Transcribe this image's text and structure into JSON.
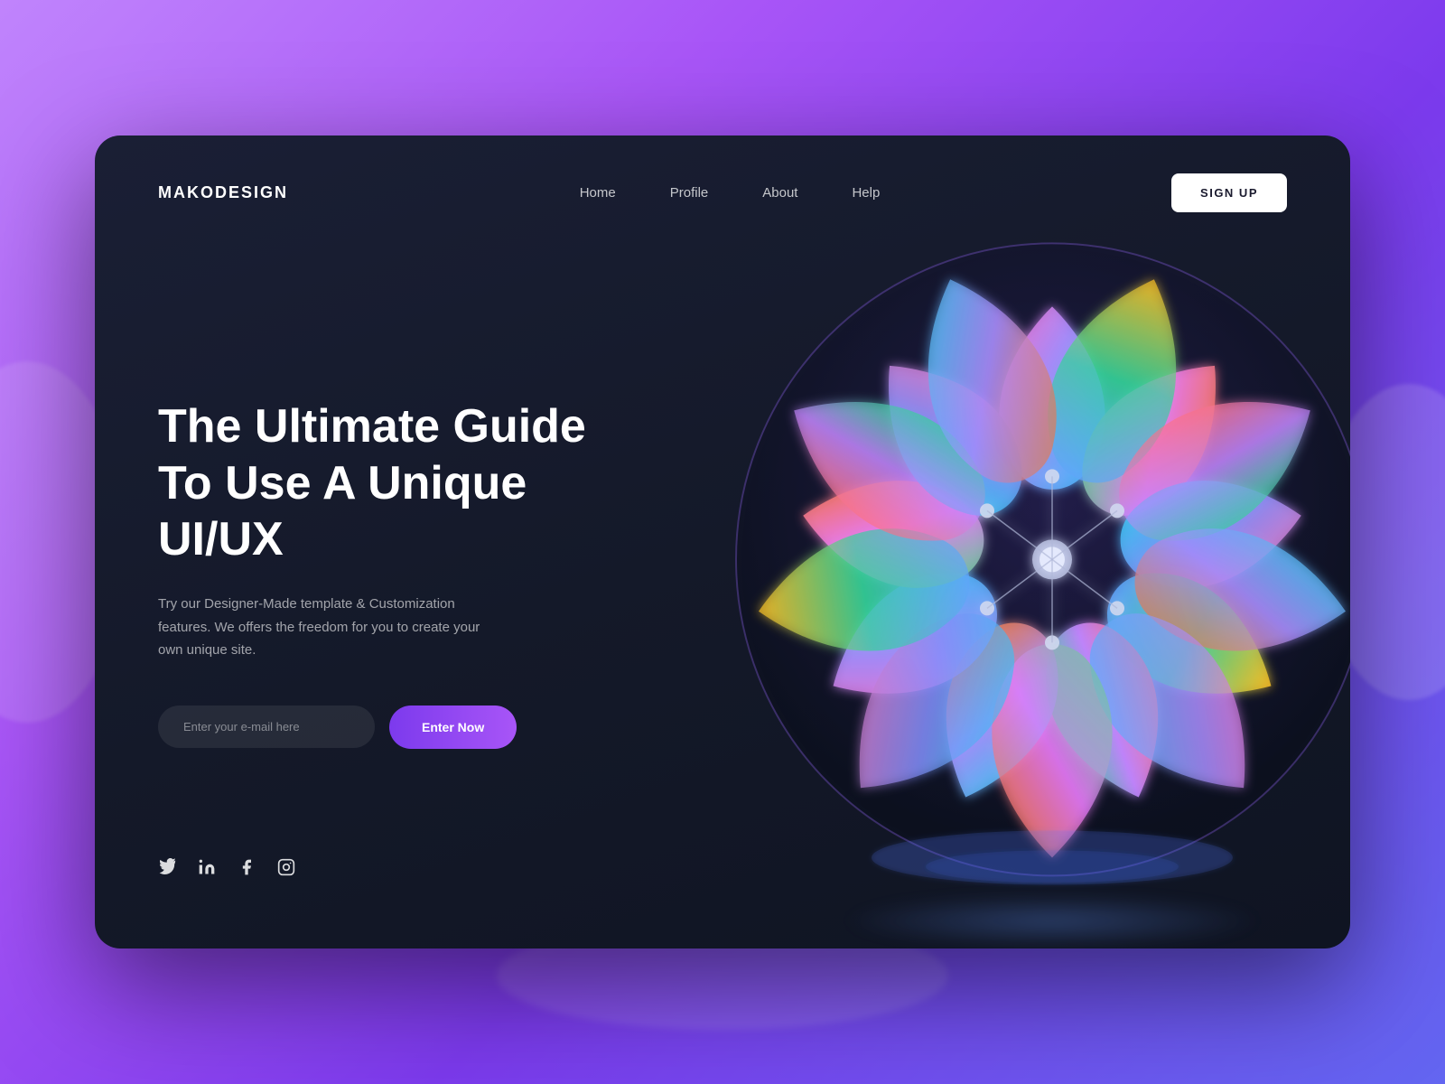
{
  "background": {
    "gradient_start": "#c084fc",
    "gradient_end": "#6366f1"
  },
  "card": {
    "bg": "#141929"
  },
  "navbar": {
    "logo": "MAKODESIGN",
    "links": [
      {
        "label": "Home",
        "href": "#"
      },
      {
        "label": "Profile",
        "href": "#"
      },
      {
        "label": "About",
        "href": "#"
      },
      {
        "label": "Help",
        "href": "#"
      }
    ],
    "signup_label": "SIGN UP"
  },
  "hero": {
    "title": "The Ultimate Guide To Use A Unique UI/UX",
    "subtitle": "Try our Designer-Made template & Customization features. We offers the freedom for you to create your own unique site.",
    "email_placeholder": "Enter your e-mail here",
    "cta_label": "Enter Now"
  },
  "social": {
    "icons": [
      "twitter",
      "linkedin",
      "facebook",
      "instagram"
    ]
  }
}
